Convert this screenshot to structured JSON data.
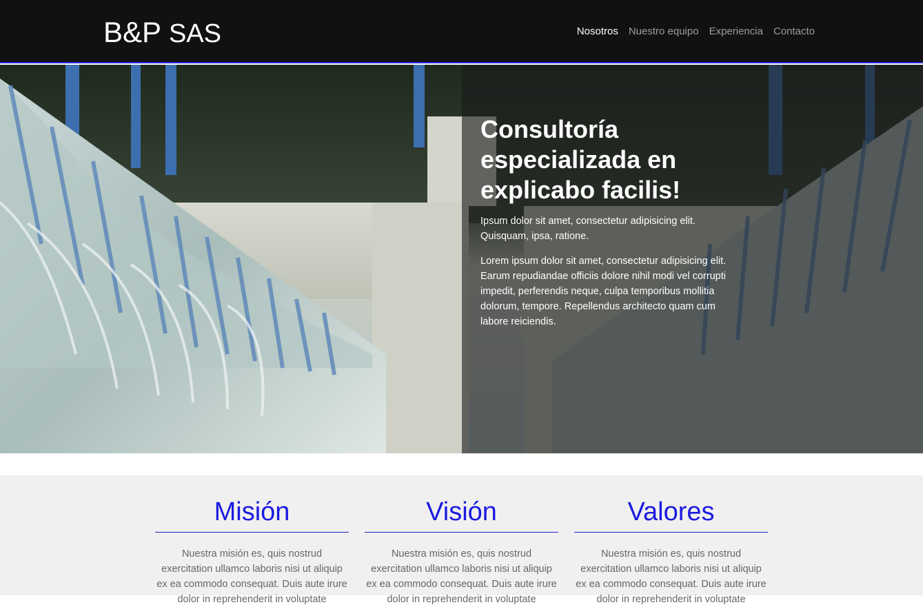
{
  "brand": {
    "strong": "B&P",
    "light": "SAS"
  },
  "nav": {
    "items": [
      {
        "label": "Nosotros",
        "active": true
      },
      {
        "label": "Nuestro equipo",
        "active": false
      },
      {
        "label": "Experiencia",
        "active": false
      },
      {
        "label": "Contacto",
        "active": false
      }
    ]
  },
  "hero": {
    "title": "Consultoría especializada en explicabo facilis!",
    "paragraph_1": "Ipsum dolor sit amet, consectetur adipisicing elit. Quisquam, ipsa, ratione.",
    "paragraph_2": "Lorem ipsum dolor sit amet, consectetur adipisicing elit. Earum repudiandae officiis dolore nihil modi vel corrupti impedit, perferendis neque, culpa temporibus mollitia dolorum, tempore. Repellendus architecto quam cum labore reiciendis."
  },
  "features": [
    {
      "title": "Misión",
      "text": "Nuestra misión es, quis nostrud exercitation ullamco laboris nisi ut aliquip ex ea commodo consequat. Duis aute irure dolor in reprehenderit in voluptate"
    },
    {
      "title": "Visión",
      "text": "Nuestra misión es, quis nostrud exercitation ullamco laboris nisi ut aliquip ex ea commodo consequat. Duis aute irure dolor in reprehenderit in voluptate"
    },
    {
      "title": "Valores",
      "text": "Nuestra misión es, quis nostrud exercitation ullamco laboris nisi ut aliquip ex ea commodo consequat. Duis aute irure dolor in reprehenderit in voluptate"
    }
  ],
  "colors": {
    "navbar_bg": "#111111",
    "accent": "#1a1adf",
    "features_bg": "#f0f0f0"
  }
}
